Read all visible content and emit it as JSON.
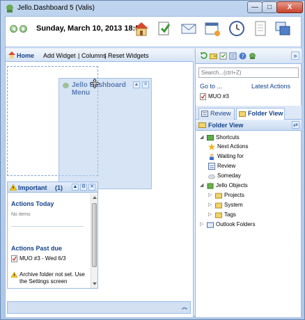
{
  "window": {
    "title": "Jello.Dashboard 5 (Valis)",
    "minimize_label": "—",
    "maximize_label": "□",
    "close_label": "X"
  },
  "toolbar": {
    "datetime": "Sunday, March 10, 2013 18:57"
  },
  "left_toolbar": {
    "home": "Home",
    "add_widget": "Add Widget",
    "columns": "Columns",
    "reset_widgets": "Reset Widgets",
    "separator": "|"
  },
  "drag_widget": {
    "title": "Jello Dashboard Menu"
  },
  "important_widget": {
    "title": "Important",
    "count": "(1)",
    "actions_today": "Actions Today",
    "no_items": "No items",
    "actions_past_due": "Actions Past due",
    "task": "MUO #3 - Wed 6/3",
    "archive_warning": "Archive folder not set. Use the Settings screen"
  },
  "right_panel": {
    "search_placeholder": "Search...(ctrl+Z)",
    "goto": "Go to ...",
    "latest_actions": "Latest Actions",
    "recent_item": "MUO #3",
    "tabs": [
      {
        "label": "Review",
        "active": false
      },
      {
        "label": "Folder View",
        "active": true
      }
    ],
    "folder_view_title": "Folder View",
    "tree": [
      {
        "label": "Shortcuts",
        "icon": "folder-green-icon",
        "expanded": true,
        "level": 0
      },
      {
        "label": "Next Actions",
        "icon": "star-icon",
        "level": 1
      },
      {
        "label": "Waiting for",
        "icon": "person-icon",
        "level": 1
      },
      {
        "label": "Review",
        "icon": "review-icon",
        "level": 1
      },
      {
        "label": "Someday",
        "icon": "cloud-icon",
        "level": 1
      },
      {
        "label": "Jello Objects",
        "icon": "puzzle-icon",
        "expanded": true,
        "level": 0
      },
      {
        "label": "Projects",
        "icon": "folder-icon",
        "expanded": false,
        "level": 1
      },
      {
        "label": "System",
        "icon": "folder-icon",
        "expanded": false,
        "level": 1
      },
      {
        "label": "Tags",
        "icon": "folder-icon",
        "expanded": false,
        "level": 1
      },
      {
        "label": "Outlook Folders",
        "icon": "outlook-folder-icon",
        "expanded": false,
        "level": 0
      }
    ]
  },
  "colors": {
    "accent": "#15428b",
    "panel_border": "#99bbe8",
    "background": "#dfe8f6"
  }
}
